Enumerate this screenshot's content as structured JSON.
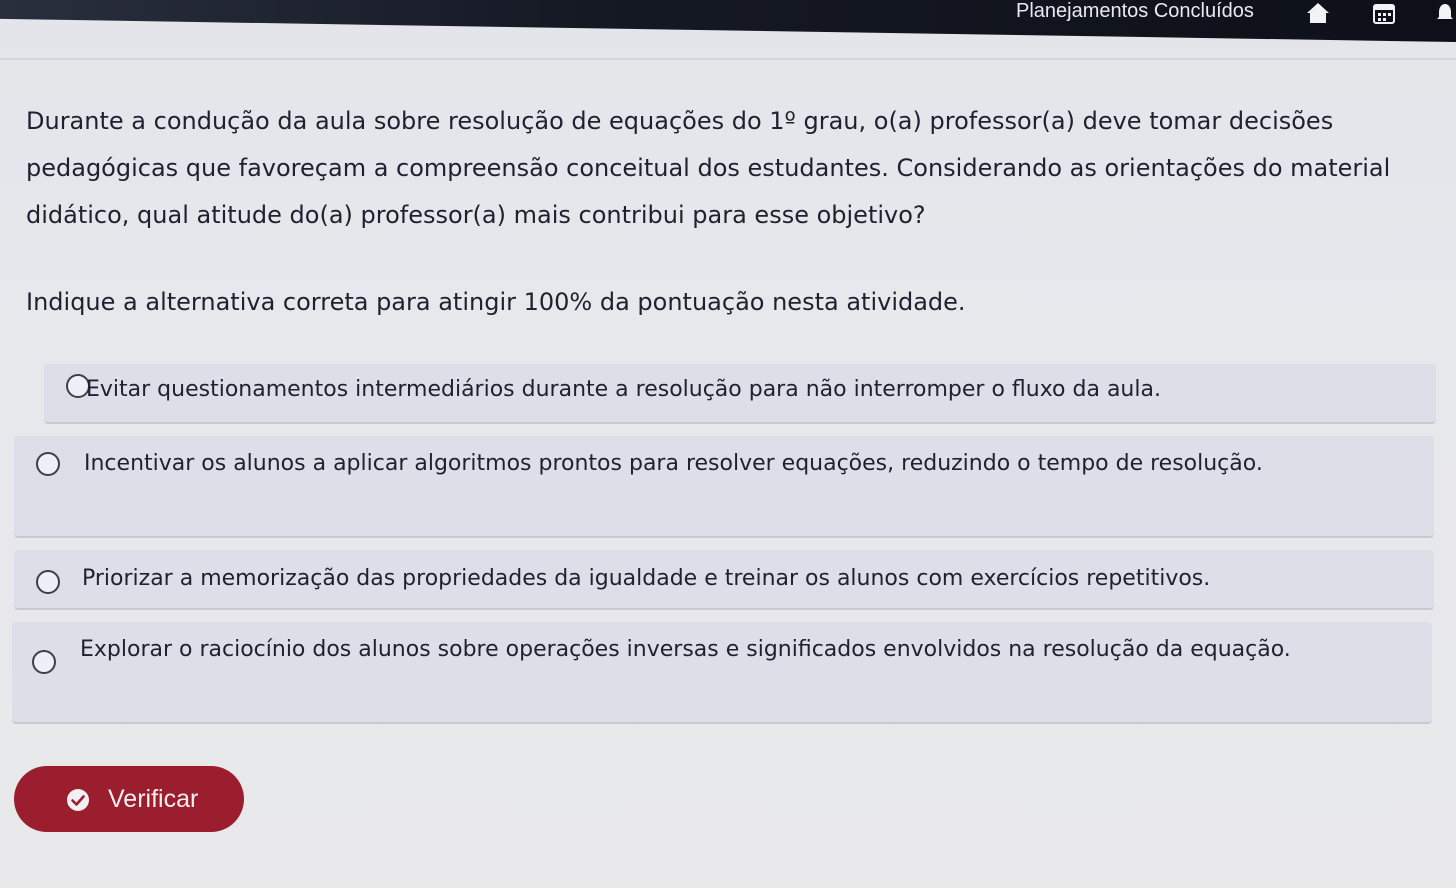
{
  "header": {
    "title": "Planejamentos Concluídos",
    "icons": [
      "home-icon",
      "calendar-icon",
      "notification-icon"
    ]
  },
  "question": {
    "text": "Durante a condução da aula sobre resolução de equações do 1º grau, o(a) professor(a) deve tomar decisões pedagógicas que favoreçam a compreensão conceitual dos estudantes. Considerando as orientações do material didático, qual atitude do(a) professor(a) mais contribui para esse objetivo?",
    "instruction": "Indique a alternativa correta para atingir 100% da pontuação nesta atividade."
  },
  "options": [
    {
      "label": "Evitar questionamentos intermediários durante a resolução para não interromper o fluxo da aula.",
      "selected": false
    },
    {
      "label": "Incentivar os alunos a aplicar algoritmos prontos para resolver equações, reduzindo o tempo de resolução.",
      "selected": false
    },
    {
      "label": "Priorizar a memorização das propriedades da igualdade e treinar os alunos com exercícios repetitivos.",
      "selected": false
    },
    {
      "label": "Explorar o raciocínio dos alunos sobre operações inversas e significados envolvidos na resolução da equação.",
      "selected": false
    }
  ],
  "verify_button": {
    "label": "Verificar",
    "icon": "check-circle-icon",
    "color": "#9b1e2e"
  },
  "colors": {
    "topbar": "#151924",
    "option_bg": "#dcdfe8",
    "text": "#1e2230"
  }
}
